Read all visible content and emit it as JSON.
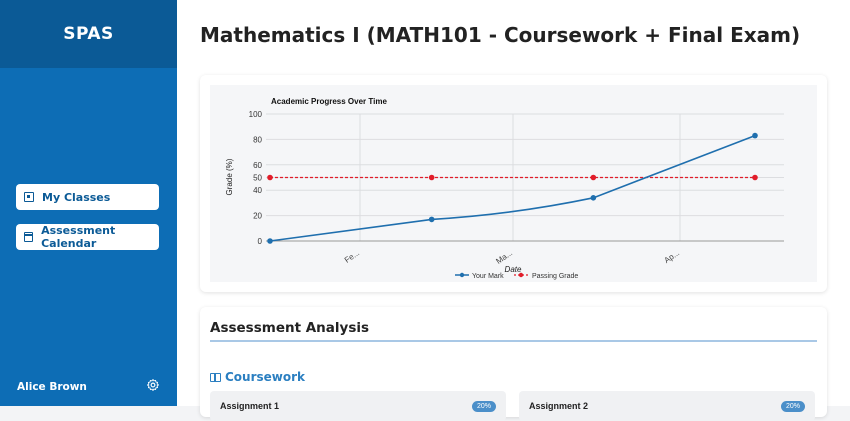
{
  "sidebar": {
    "brand": "SPAS",
    "items": [
      {
        "label": "My Classes",
        "icon": "book-icon"
      },
      {
        "label": "Assessment Calendar",
        "icon": "calendar-icon"
      }
    ],
    "user": "Alice Brown",
    "settings_icon": "gear-icon"
  },
  "main": {
    "title": "Mathematics I (MATH101 - Coursework + Final Exam)",
    "analysis_title": "Assessment Analysis",
    "coursework_label": "Coursework",
    "assignments": [
      {
        "name": "Assignment 1",
        "weight": "20%"
      },
      {
        "name": "Assignment 2",
        "weight": "20%"
      }
    ]
  },
  "chart_data": {
    "type": "line",
    "title": "Academic Progress Over Time",
    "xlabel": "Date",
    "ylabel": "Grade (%)",
    "ylim": [
      0,
      100
    ],
    "yticks": [
      0,
      20,
      40,
      50,
      60,
      80,
      100
    ],
    "xticks": [
      "Fe...",
      "Ma...",
      "Ap..."
    ],
    "x": [
      "2025-01-26",
      "2025-02-26",
      "2025-03-26",
      "2025-04-26"
    ],
    "series": [
      {
        "name": "Your Mark",
        "color": "#1f6fae",
        "values": [
          0,
          17,
          34,
          83
        ]
      },
      {
        "name": "Passing Grade",
        "color": "#e11d2a",
        "values": [
          50,
          50,
          50,
          50
        ]
      }
    ],
    "grid": true,
    "legend": "bottom"
  }
}
